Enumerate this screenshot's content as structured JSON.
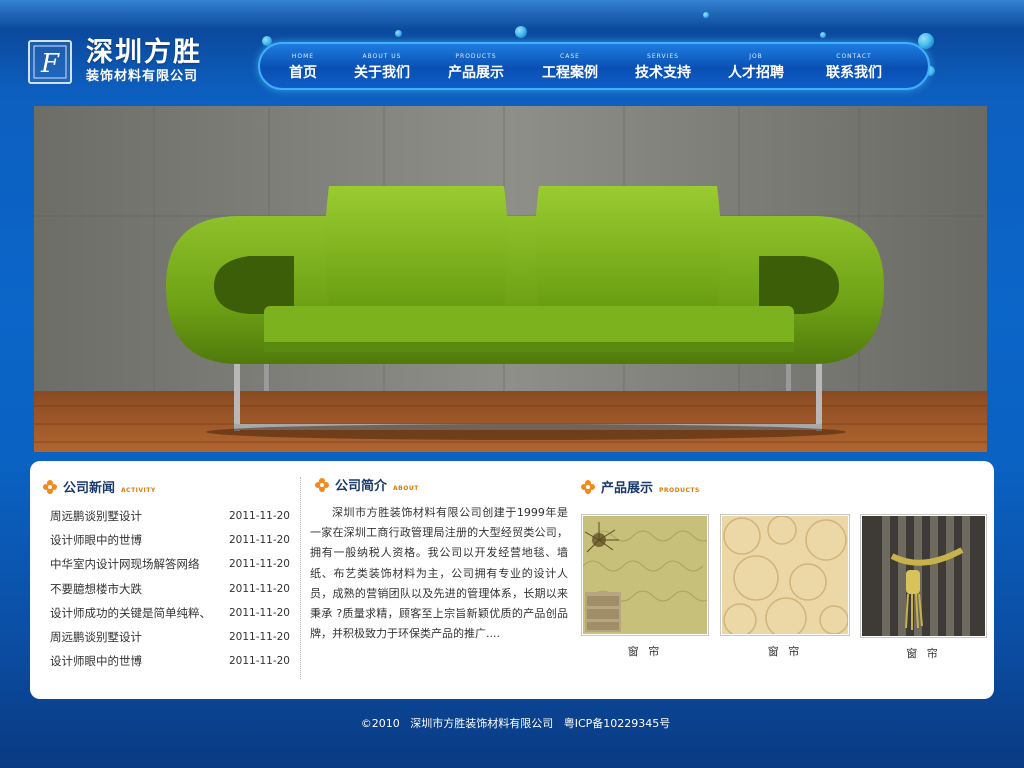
{
  "header": {
    "logo_letter": "F",
    "title": "深圳方胜",
    "subtitle": "装饰材料有限公司"
  },
  "nav": {
    "items": [
      {
        "en": "HOME",
        "cn": "首页"
      },
      {
        "en": "ABOUT US",
        "cn": "关于我们"
      },
      {
        "en": "PRODUCTS",
        "cn": "产品展示"
      },
      {
        "en": "CASE",
        "cn": "工程案例"
      },
      {
        "en": "SERVIES",
        "cn": "技术支持"
      },
      {
        "en": "JOB",
        "cn": "人才招聘"
      },
      {
        "en": "CONTACT",
        "cn": "联系我们"
      }
    ]
  },
  "news": {
    "title": "公司新闻",
    "title_en": "ACTIVITY",
    "items": [
      {
        "title": "周远鹏谈别墅设计",
        "date": "2011-11-20"
      },
      {
        "title": "设计师眼中的世博",
        "date": "2011-11-20"
      },
      {
        "title": "中华室内设计网现场解答网络",
        "date": "2011-11-20"
      },
      {
        "title": "不要臆想楼市大跌",
        "date": "2011-11-20"
      },
      {
        "title": "设计师成功的关键是简单纯粹、",
        "date": "2011-11-20"
      },
      {
        "title": "周远鹏谈别墅设计",
        "date": "2011-11-20"
      },
      {
        "title": "设计师眼中的世博",
        "date": "2011-11-20"
      }
    ]
  },
  "about": {
    "title": "公司简介",
    "title_en": "ABOUT",
    "text": "深圳市方胜装饰材料有限公司创建于1999年是一家在深圳工商行政管理局注册的大型经贸类公司，拥有一般纳税人资格。我公司以开发经营地毯、墙纸、布艺类装饰材料为主，公司拥有专业的设计人员，成熟的营销团队以及先进的管理体系，长期以来秉承 ?质量求精，顾客至上宗旨新颖优质的产品创品牌，并积极致力于环保类产品的推广...."
  },
  "products": {
    "title": "产品展示",
    "title_en": "PRODUCTS",
    "items": [
      {
        "label": "窗 帘"
      },
      {
        "label": "窗 帘"
      },
      {
        "label": "窗 帘"
      }
    ]
  },
  "footer": {
    "copyright": "©2010",
    "company": "深圳市方胜装饰材料有限公司",
    "icp": "粤ICP备10229345号"
  },
  "colors": {
    "background": "#0b66c9",
    "nav_border": "#3fb0ff",
    "accent_orange": "#e07a00",
    "section_title": "#1a3a6e"
  }
}
